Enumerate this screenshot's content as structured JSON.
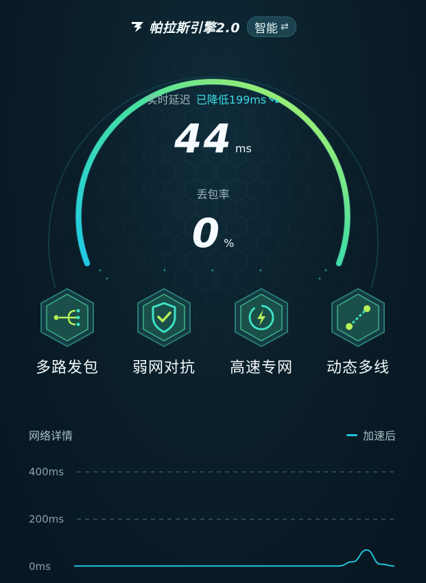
{
  "header": {
    "title": "帕拉斯引擎2.0",
    "mode_label": "智能",
    "mode_icon": "swap-icon"
  },
  "gauge": {
    "latency_label": "实时延迟",
    "latency_reduction": "已降低199ms",
    "latency_value": "44",
    "latency_unit": "ms",
    "loss_label": "丢包率",
    "loss_value": "0",
    "loss_unit": "%",
    "colors": {
      "arc_start": "#1ec9e6",
      "arc_end": "#c9f55a"
    }
  },
  "features": [
    {
      "label": "多路发包",
      "icon": "multipath-icon"
    },
    {
      "label": "弱网对抗",
      "icon": "shield-check-icon"
    },
    {
      "label": "高速专网",
      "icon": "lightning-icon"
    },
    {
      "label": "动态多线",
      "icon": "route-line-icon"
    }
  ],
  "network": {
    "title": "网络详情",
    "legend": "加速后",
    "color": "#22c3dd"
  },
  "chart_data": {
    "type": "line",
    "series": [
      {
        "name": "加速后",
        "values": [
          2,
          2,
          2,
          2,
          2,
          2,
          2,
          2,
          2,
          2,
          2,
          2,
          2,
          2,
          2,
          2,
          2,
          2,
          2,
          2,
          20,
          70,
          10,
          2
        ]
      }
    ],
    "y_ticks": [
      "400ms",
      "200ms",
      "0ms"
    ],
    "ylim": [
      0,
      400
    ],
    "grid": true,
    "legend_placement": "top-right"
  }
}
